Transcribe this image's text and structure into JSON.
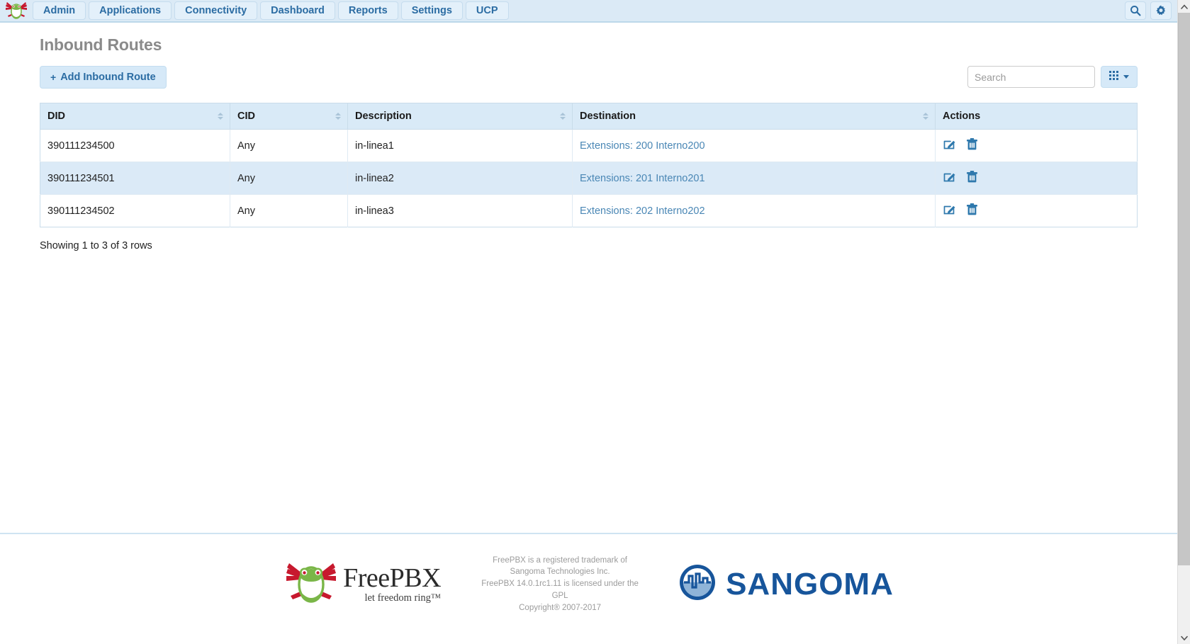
{
  "navbar": {
    "brand_icon": "freepbx-frog-logo",
    "items": [
      {
        "label": "Admin"
      },
      {
        "label": "Applications"
      },
      {
        "label": "Connectivity"
      },
      {
        "label": "Dashboard"
      },
      {
        "label": "Reports"
      },
      {
        "label": "Settings"
      },
      {
        "label": "UCP"
      }
    ],
    "search_icon": "search-icon",
    "gear_icon": "gear-icon"
  },
  "page": {
    "title": "Inbound Routes"
  },
  "toolbar": {
    "add_label": "Add Inbound Route",
    "add_plus": "+",
    "search_placeholder": "Search",
    "search_value": "",
    "columns_icon": "grid-icon"
  },
  "table": {
    "columns": [
      {
        "label": "DID",
        "sortable": true
      },
      {
        "label": "CID",
        "sortable": true
      },
      {
        "label": "Description",
        "sortable": true
      },
      {
        "label": "Destination",
        "sortable": true
      },
      {
        "label": "Actions",
        "sortable": false
      }
    ],
    "rows": [
      {
        "did": "390111234500",
        "cid": "Any",
        "description": "in-linea1",
        "destination": "Extensions: 200 Interno200"
      },
      {
        "did": "390111234501",
        "cid": "Any",
        "description": "in-linea2",
        "destination": "Extensions: 201 Interno201"
      },
      {
        "did": "390111234502",
        "cid": "Any",
        "description": "in-linea3",
        "destination": "Extensions: 202 Interno202"
      }
    ],
    "edit_icon": "edit-pencil-icon",
    "delete_icon": "trash-icon",
    "rows_info": "Showing 1 to 3 of 3 rows"
  },
  "footer": {
    "product_name": "FreePBX",
    "tagline": "let freedom ring™",
    "legal_line1": "FreePBX is a registered trademark of",
    "legal_line2": "Sangoma Technologies Inc.",
    "legal_line3": "FreePBX 14.0.1rc1.11 is licensed under the GPL",
    "legal_line4": "Copyright® 2007-2017",
    "sangoma_name": "SANGOMA"
  },
  "colors": {
    "nav_bg": "#dbeaf6",
    "nav_text": "#2b6ca3",
    "link": "#4a87b5",
    "table_header_bg": "#d9eaf7",
    "row_alt_bg": "#dbeaf7",
    "title_gray": "#8a8a8a",
    "sangoma_blue": "#17559b"
  }
}
